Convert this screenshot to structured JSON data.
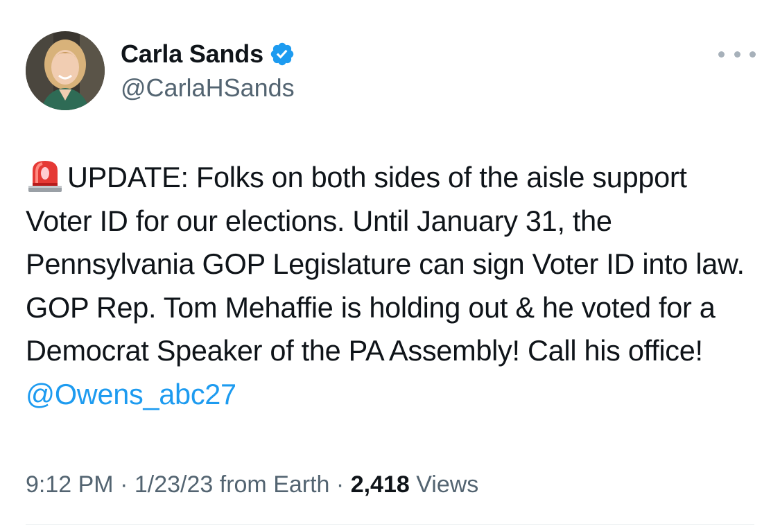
{
  "author": {
    "display_name": "Carla Sands",
    "handle": "@CarlaHSands",
    "verified": true,
    "avatar_icon": "profile-photo"
  },
  "header": {
    "more_icon": "more-horizontal-icon"
  },
  "tweet": {
    "emoji_icon": "rotating-light-siren-icon",
    "body_text": "UPDATE: Folks on both sides of the aisle support Voter ID for our elections. Until January 31, the Pennsylvania GOP Legislature can sign Voter ID into law. GOP Rep. Tom Mehaffie is holding out & he voted for a Democrat Speaker of the PA Assembly! Call his office! ",
    "mention": "@Owens_abc27"
  },
  "meta": {
    "time": "9:12 PM",
    "sep1": " · ",
    "date": "1/23/23",
    "source": " from Earth",
    "sep2": " · ",
    "views_count": "2,418",
    "views_label": " Views"
  },
  "colors": {
    "link": "#1d9bf0",
    "secondary_text": "#536471",
    "primary_text": "#0f1419",
    "verified_badge": "#1d9bf0"
  }
}
